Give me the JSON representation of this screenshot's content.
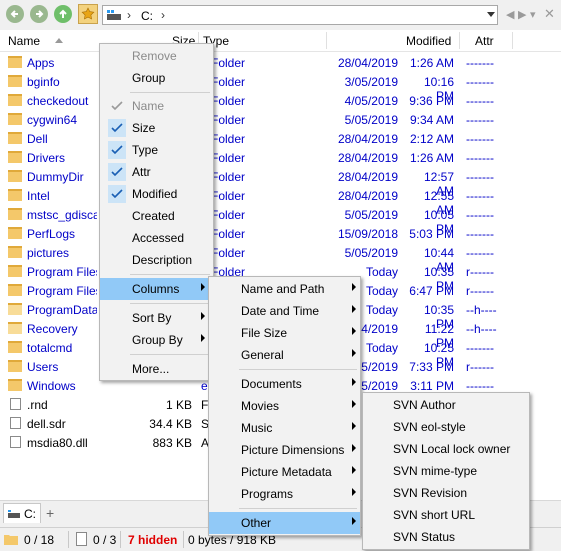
{
  "address": {
    "path": "C:"
  },
  "columns": {
    "name": "Name",
    "size": "Size",
    "type": "Type",
    "modified": "Modified",
    "attr": "Attr"
  },
  "files": [
    {
      "name": "Apps",
      "size": "",
      "type": "e Folder",
      "date": "28/04/2019",
      "time": "1:26 AM",
      "attr": "-------",
      "kind": "folder"
    },
    {
      "name": "bginfo",
      "size": "",
      "type": "e Folder",
      "date": "3/05/2019",
      "time": "10:16 PM",
      "attr": "-------",
      "kind": "folder"
    },
    {
      "name": "checkedout",
      "size": "",
      "type": "e Folder",
      "date": "4/05/2019",
      "time": "9:36 PM",
      "attr": "-------",
      "kind": "folder"
    },
    {
      "name": "cygwin64",
      "size": "",
      "type": "e Folder",
      "date": "5/05/2019",
      "time": "9:34 AM",
      "attr": "-------",
      "kind": "folder"
    },
    {
      "name": "Dell",
      "size": "",
      "type": "e Folder",
      "date": "28/04/2019",
      "time": "2:12 AM",
      "attr": "-------",
      "kind": "folder"
    },
    {
      "name": "Drivers",
      "size": "",
      "type": "e Folder",
      "date": "28/04/2019",
      "time": "1:26 AM",
      "attr": "-------",
      "kind": "folder"
    },
    {
      "name": "DummyDir",
      "size": "",
      "type": "e Folder",
      "date": "28/04/2019",
      "time": "12:57 AM",
      "attr": "-------",
      "kind": "folder"
    },
    {
      "name": "Intel",
      "size": "",
      "type": "e Folder",
      "date": "28/04/2019",
      "time": "12:55 AM",
      "attr": "-------",
      "kind": "folder"
    },
    {
      "name": "mstsc_gdisca",
      "size": "",
      "type": "e Folder",
      "date": "5/05/2019",
      "time": "10:05 PM",
      "attr": "-------",
      "kind": "folder"
    },
    {
      "name": "PerfLogs",
      "size": "",
      "type": "e Folder",
      "date": "15/09/2018",
      "time": "5:03 PM",
      "attr": "-------",
      "kind": "folder"
    },
    {
      "name": "pictures",
      "size": "",
      "type": "e Folder",
      "date": "5/05/2019",
      "time": "10:44 AM",
      "attr": "-------",
      "kind": "folder"
    },
    {
      "name": "Program Files",
      "size": "",
      "type": "e Folder",
      "date": "Today",
      "time": "10:35 PM",
      "attr": "r------",
      "kind": "folder"
    },
    {
      "name": "Program Files",
      "size": "",
      "type": "e Folder",
      "date": "Today",
      "time": "6:47 PM",
      "attr": "r------",
      "kind": "folder"
    },
    {
      "name": "ProgramData",
      "size": "",
      "type": "e Folder",
      "date": "Today",
      "time": "10:35 PM",
      "attr": "--h----",
      "kind": "sysfolder"
    },
    {
      "name": "Recovery",
      "size": "",
      "type": "e Folder",
      "date": "4/2019",
      "time": "11:22 PM",
      "attr": "--h----",
      "kind": "sysfolder"
    },
    {
      "name": "totalcmd",
      "size": "",
      "type": "e Folder",
      "date": "Today",
      "time": "10:25 PM",
      "attr": "-------",
      "kind": "folder"
    },
    {
      "name": "Users",
      "size": "",
      "type": "e Folder",
      "date": "5/2019",
      "time": "7:33 PM",
      "attr": "r------",
      "kind": "folder"
    },
    {
      "name": "Windows",
      "size": "",
      "type": "e Folder",
      "date": "5/2019",
      "time": "3:11 PM",
      "attr": "-------",
      "kind": "folder"
    },
    {
      "name": ".rnd",
      "size": "1 KB",
      "type": "F",
      "date": "",
      "time": "",
      "attr": "",
      "kind": "file"
    },
    {
      "name": "dell.sdr",
      "size": "34.4 KB",
      "type": "S",
      "date": "",
      "time": "",
      "attr": "",
      "kind": "file"
    },
    {
      "name": "msdia80.dll",
      "size": "883 KB",
      "type": "A",
      "date": "",
      "time": "",
      "attr": "",
      "kind": "file"
    }
  ],
  "tab": {
    "label": "C:"
  },
  "status": {
    "folders": "0 / 18",
    "files": "0 / 3",
    "hidden": "7 hidden",
    "bytes": "0 bytes / 918 KB"
  },
  "menu_main": {
    "remove": "Remove",
    "group": "Group",
    "name": "Name",
    "size": "Size",
    "type": "Type",
    "attr": "Attr",
    "modified": "Modified",
    "created": "Created",
    "accessed": "Accessed",
    "description": "Description",
    "columns": "Columns",
    "sort_by": "Sort By",
    "group_by": "Group By",
    "more": "More..."
  },
  "menu_columns": {
    "name_path": "Name and Path",
    "date_time": "Date and Time",
    "file_size": "File Size",
    "general": "General",
    "documents": "Documents",
    "movies": "Movies",
    "music": "Music",
    "picture_dimensions": "Picture Dimensions",
    "picture_metadata": "Picture Metadata",
    "programs": "Programs",
    "other": "Other"
  },
  "menu_other": {
    "svn_author": "SVN Author",
    "svn_eol_style": "SVN eol-style",
    "svn_local_lock_owner": "SVN Local lock owner",
    "svn_mime_type": "SVN mime-type",
    "svn_revision": "SVN Revision",
    "svn_short_url": "SVN short URL",
    "svn_status": "SVN Status"
  }
}
